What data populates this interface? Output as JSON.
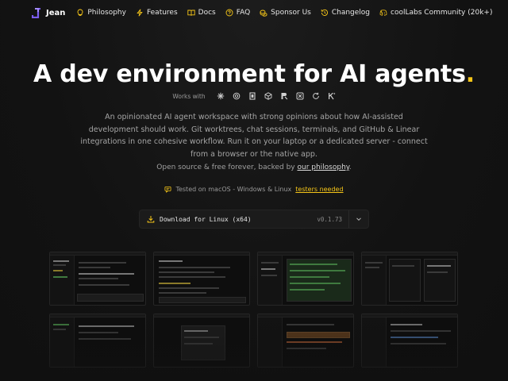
{
  "nav": {
    "brand": "Jean",
    "items": [
      {
        "label": "Philosophy",
        "icon": "lightbulb-icon"
      },
      {
        "label": "Features",
        "icon": "lightning-icon"
      },
      {
        "label": "Docs",
        "icon": "book-icon"
      },
      {
        "label": "FAQ",
        "icon": "question-circle-icon"
      },
      {
        "label": "Sponsor Us",
        "icon": "coins-icon"
      },
      {
        "label": "Changelog",
        "icon": "history-icon"
      },
      {
        "label": "coolLabs Community (20k+)",
        "icon": "discord-icon"
      }
    ]
  },
  "hero": {
    "title": "A dev environment for AI agents",
    "title_dot": ".",
    "works_with_label": "Works with",
    "works_with_icons": [
      "claude-icon",
      "openai-icon",
      "opencode-icon",
      "cube-icon",
      "cursor-icon",
      "grid-icon",
      "refresh-icon",
      "k-icon"
    ],
    "description": "An opinionated AI agent workspace with strong opinions about how AI-assisted development should work. Git worktrees, chat sessions, terminals, and GitHub & Linear integrations in one cohesive workflow. Run it on your laptop or a dedicated server - connect from a browser or the native app.",
    "open_source_prefix": "Open source & free forever, backed by ",
    "open_source_link": "our philosophy",
    "open_source_suffix": ".",
    "tested_prefix": "Tested on macOS - Windows & Linux ",
    "tested_link": "testers needed"
  },
  "download": {
    "label": "Download for Linux (x64)",
    "version": "v0.1.73"
  },
  "colors": {
    "accent": "#f5c518",
    "brand": "#7b5cf0",
    "background": "#121212"
  }
}
